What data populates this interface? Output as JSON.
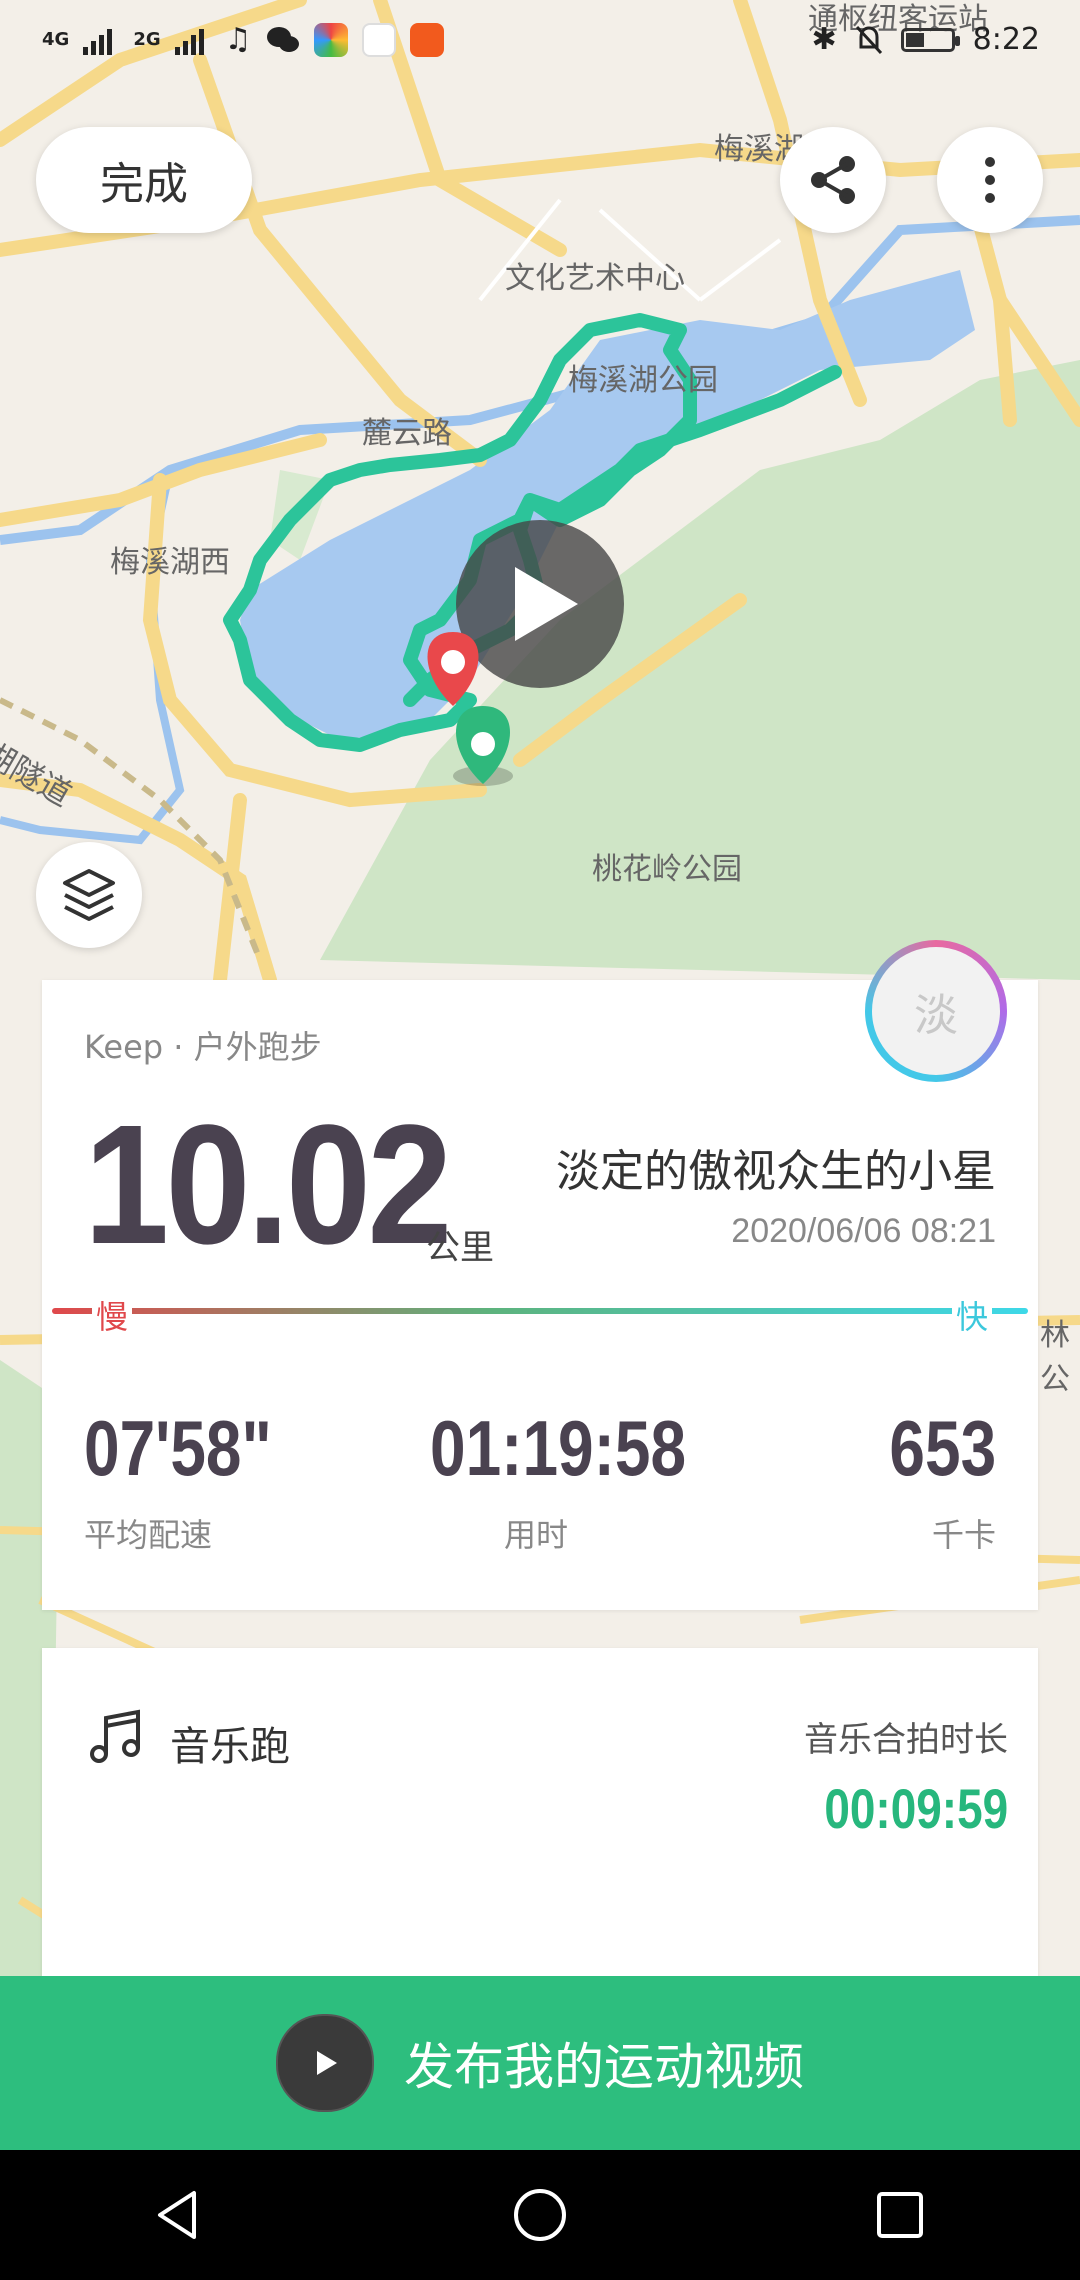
{
  "status_bar": {
    "network_1": "4G",
    "network_2": "2G",
    "time": "8:22"
  },
  "map": {
    "labels": {
      "station": "通枢纽客运站",
      "meixi": "梅溪湖",
      "culture_center": "文化艺术中心",
      "meixi_park": "梅溪湖公园",
      "luyun_road": "麓云路",
      "meixi_west": "梅溪湖西",
      "tunnel": "湖隧道",
      "taohua_park": "桃花岭公园",
      "edge_partial": "林公"
    }
  },
  "header": {
    "done_label": "完成",
    "share_icon": "share-icon",
    "more_icon": "more-vertical-icon"
  },
  "summary": {
    "source": "Keep · 户外跑步",
    "distance": "10.02",
    "unit": "公里",
    "username": "淡定的傲视众生的小星",
    "datetime": "2020/06/06 08:21",
    "avatar_char": "淡",
    "slow_label": "慢",
    "fast_label": "快",
    "stats": [
      {
        "value": "07'58\"",
        "label": "平均配速"
      },
      {
        "value": "01:19:58",
        "label": "用时"
      },
      {
        "value": "653",
        "label": "千卡"
      }
    ]
  },
  "music": {
    "title": "音乐跑",
    "sync_label": "音乐合拍时长",
    "sync_value": "00:09:59"
  },
  "publish": {
    "label": "发布我的运动视频"
  },
  "colors": {
    "accent": "#2dbe7e",
    "route": "#2cc49a",
    "water": "#a7c9f0"
  }
}
